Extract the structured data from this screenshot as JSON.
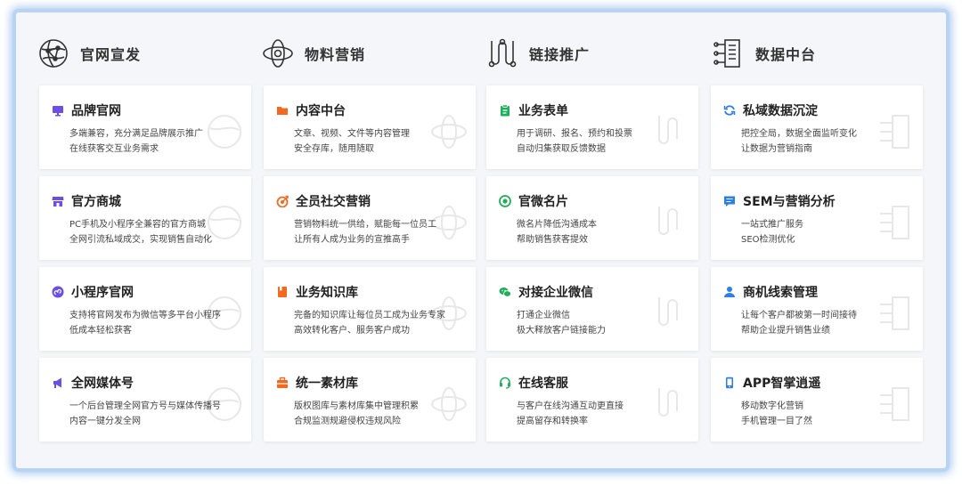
{
  "columns": [
    {
      "title": "官网宣发",
      "icon": "globe-network-icon",
      "cards": [
        {
          "title": "品牌官网",
          "icon": "monitor-icon",
          "color": "#6c4de6",
          "lines": [
            "多端兼容，充分满足品牌展示推广",
            "在线获客交互业务需求"
          ]
        },
        {
          "title": "官方商城",
          "icon": "store-icon",
          "color": "#6c4de6",
          "lines": [
            "PC手机及小程序全兼容的官方商城",
            "全网引流私域成交，实现销售自动化"
          ]
        },
        {
          "title": "小程序官网",
          "icon": "mini-program-icon",
          "color": "#6c4de6",
          "lines": [
            "支持将官网发布为微信等多平台小程序",
            "低成本轻松获客"
          ]
        },
        {
          "title": "全网媒体号",
          "icon": "megaphone-icon",
          "color": "#6c4de6",
          "lines": [
            "一个后台管理全网官方号与媒体传播号",
            "内容一键分发全网"
          ]
        }
      ]
    },
    {
      "title": "物料营销",
      "icon": "atom-icon",
      "cards": [
        {
          "title": "内容中台",
          "icon": "folder-icon",
          "color": "#f36a1f",
          "lines": [
            "文章、视频、文件等内容管理",
            "安全存库，随用随取"
          ]
        },
        {
          "title": "全员社交营销",
          "icon": "target-icon",
          "color": "#f36a1f",
          "lines": [
            "营销物料统一供给，赋能每一位员工",
            "让所有人成为业务的宣推高手"
          ]
        },
        {
          "title": "业务知识库",
          "icon": "book-icon",
          "color": "#f36a1f",
          "lines": [
            "完备的知识库让每位员工成为业务专家",
            "高效转化客户、服务客户成功"
          ]
        },
        {
          "title": "统一素材库",
          "icon": "briefcase-icon",
          "color": "#f36a1f",
          "lines": [
            "版权图库与素材库集中管理积累",
            "合规监测规避侵权违规风险"
          ]
        }
      ]
    },
    {
      "title": "链接推广",
      "icon": "link-chain-icon",
      "cards": [
        {
          "title": "业务表单",
          "icon": "clipboard-icon",
          "color": "#1faf5a",
          "lines": [
            "用于调研、报名、预约和投票",
            "自动归集获取反馈数据"
          ]
        },
        {
          "title": "官微名片",
          "icon": "card-circle-icon",
          "color": "#1faf5a",
          "lines": [
            "微名片降低沟通成本",
            "帮助销售获客提效"
          ]
        },
        {
          "title": "对接企业微信",
          "icon": "wechat-icon",
          "color": "#1faf5a",
          "lines": [
            "打通企业微信",
            "极大释放客户链接能力"
          ]
        },
        {
          "title": "在线客服",
          "icon": "headset-icon",
          "color": "#1faf5a",
          "lines": [
            "与客户在线沟通互动更直接",
            "提高留存和转换率"
          ]
        }
      ]
    },
    {
      "title": "数据中台",
      "icon": "data-hub-icon",
      "cards": [
        {
          "title": "私域数据沉淀",
          "icon": "refresh-icon",
          "color": "#2d7fe8",
          "lines": [
            "把控全局，数据全面监听变化",
            "让数据为营销指南"
          ]
        },
        {
          "title": "SEM与营销分析",
          "icon": "chat-box-icon",
          "color": "#2d7fe8",
          "lines": [
            "一站式推广服务",
            "SEO检测优化"
          ]
        },
        {
          "title": "商机线索管理",
          "icon": "user-icon",
          "color": "#2d7fe8",
          "lines": [
            "让每个客户都被第一时间接待",
            "帮助企业提升销售业绩"
          ]
        },
        {
          "title": "APP智掌逍遥",
          "icon": "phone-icon",
          "color": "#2d7fe8",
          "lines": [
            "移动数字化营销",
            "手机管理一目了然"
          ]
        }
      ]
    }
  ]
}
